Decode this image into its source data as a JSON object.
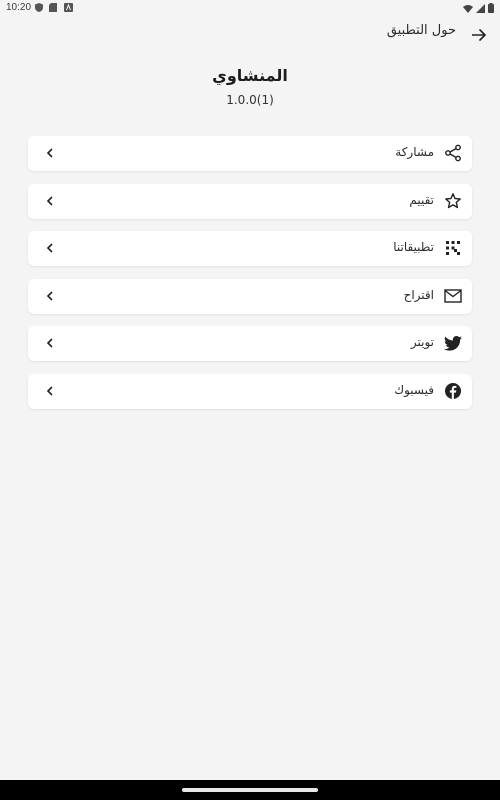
{
  "status_bar": {
    "time": "10:20"
  },
  "app_bar": {
    "title": "حول التطبيق"
  },
  "header": {
    "app_name": "المنشاوي",
    "version": "1.0.0(1)"
  },
  "menu": {
    "items": [
      {
        "label": "مشاركة",
        "icon": "share-icon"
      },
      {
        "label": "تقييم",
        "icon": "star-icon"
      },
      {
        "label": "تطبيقاتنا",
        "icon": "apps-grid-icon"
      },
      {
        "label": "اقتراح",
        "icon": "mail-icon"
      },
      {
        "label": "تويتر",
        "icon": "twitter-icon"
      },
      {
        "label": "فيسبوك",
        "icon": "facebook-icon"
      }
    ]
  },
  "colors": {
    "background": "#f4f4f4",
    "card": "#ffffff",
    "text": "#1c1c1c"
  }
}
